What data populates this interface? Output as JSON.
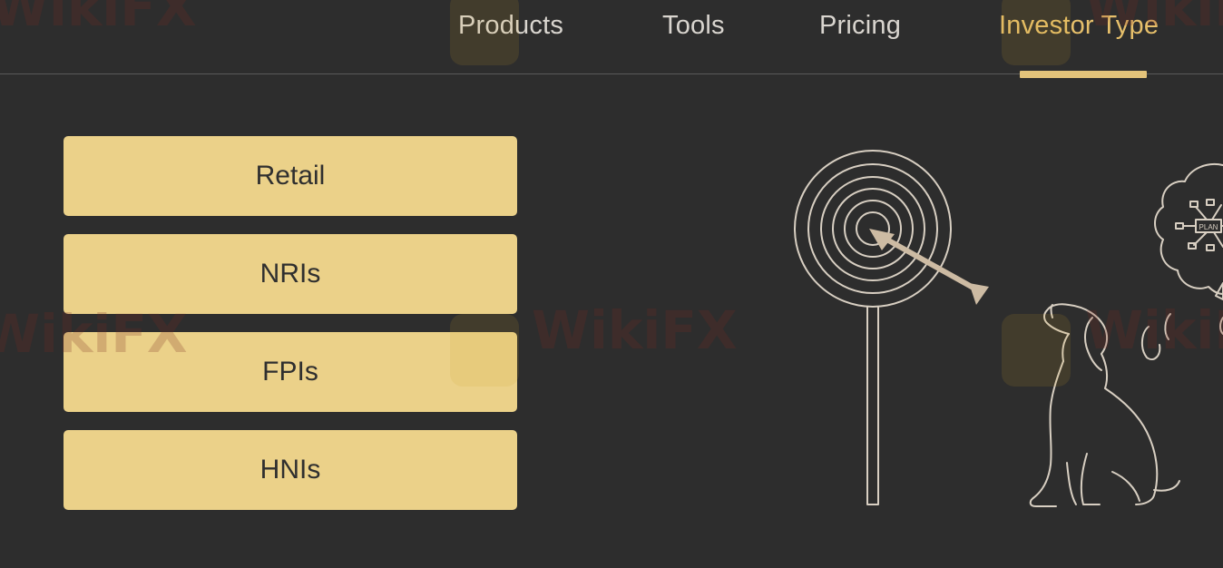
{
  "nav": {
    "items": [
      {
        "label": "Products"
      },
      {
        "label": "Tools"
      },
      {
        "label": "Pricing"
      },
      {
        "label": "Investor Type"
      }
    ]
  },
  "investor_types": [
    {
      "label": "Retail"
    },
    {
      "label": "NRIs"
    },
    {
      "label": "FPIs"
    },
    {
      "label": "HNIs"
    }
  ],
  "illustration": {
    "plan_text": "PLAN"
  },
  "watermark": {
    "text": "WikiFX"
  },
  "colors": {
    "background": "#2d2d2d",
    "accent": "#e7c06b",
    "button": "#ebd189",
    "line_art": "#d8cfc2"
  }
}
